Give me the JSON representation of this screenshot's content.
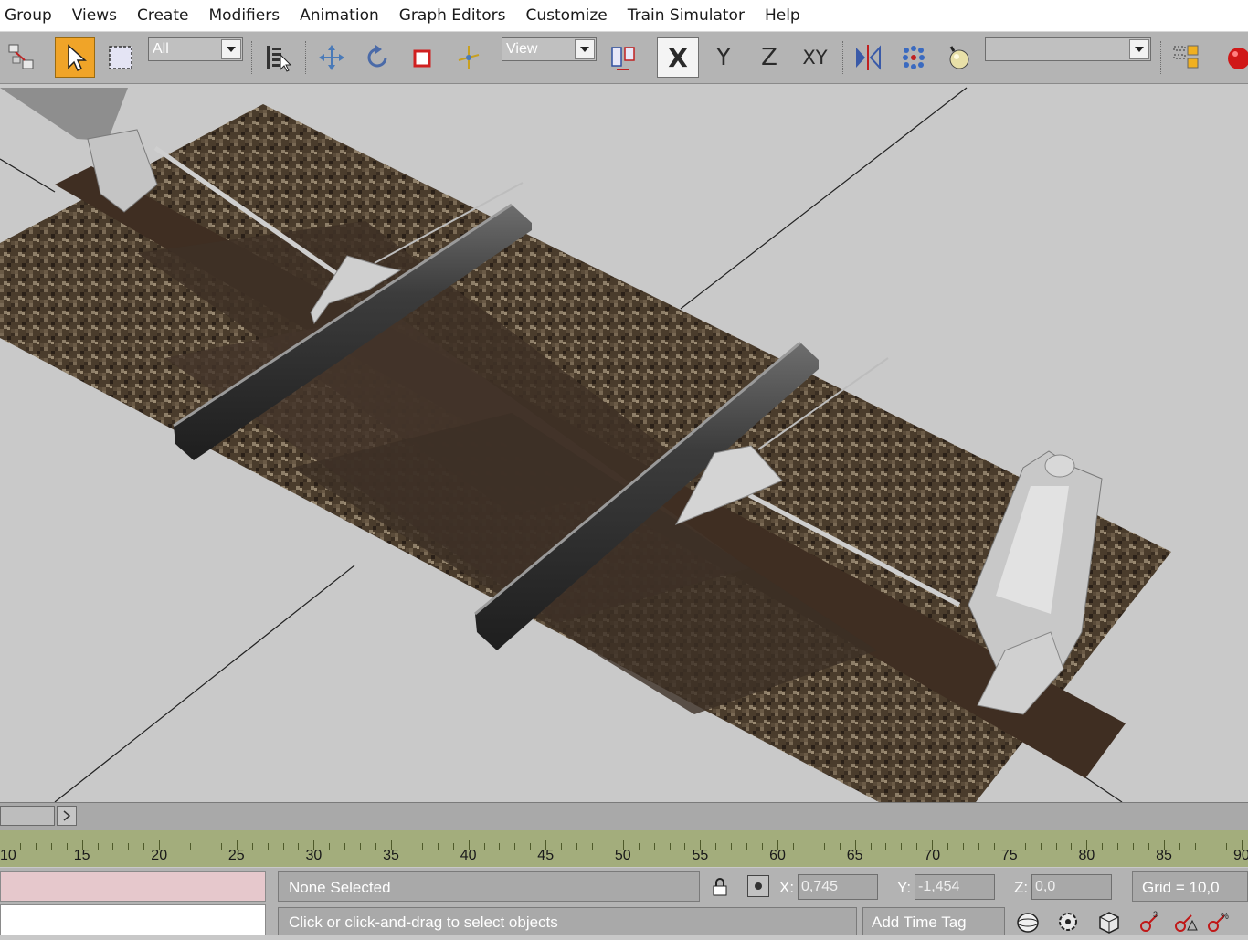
{
  "menu": [
    "Group",
    "Views",
    "Create",
    "Modifiers",
    "Animation",
    "Graph Editors",
    "Customize",
    "Train Simulator",
    "Help"
  ],
  "toolbar": {
    "selection_filter": "All",
    "reference_coord": "View",
    "axis_x": "X",
    "axis_y": "Y",
    "axis_z": "Z",
    "axis_xy": "XY",
    "named_selection": ""
  },
  "timeline": {
    "labels": [
      "10",
      "15",
      "20",
      "25",
      "30",
      "35",
      "40",
      "45",
      "50",
      "55",
      "60",
      "65",
      "70",
      "75",
      "80",
      "85",
      "90"
    ]
  },
  "status": {
    "selection": "None Selected",
    "prompt": "Click or click-and-drag to select objects",
    "x_label": "X:",
    "x_value": "0,745",
    "y_label": "Y:",
    "y_value": "-1,454",
    "z_label": "Z:",
    "z_value": "0,0",
    "grid": "Grid = 10,0",
    "add_time_tag": "Add Time Tag"
  },
  "colors": {
    "active_tool": "#f0a428",
    "viewport_bg": "#c9c9c9",
    "timeline_bg": "#a3ad7c",
    "ballast": "#4a3c2c",
    "sleeper": "#3f2e22"
  }
}
